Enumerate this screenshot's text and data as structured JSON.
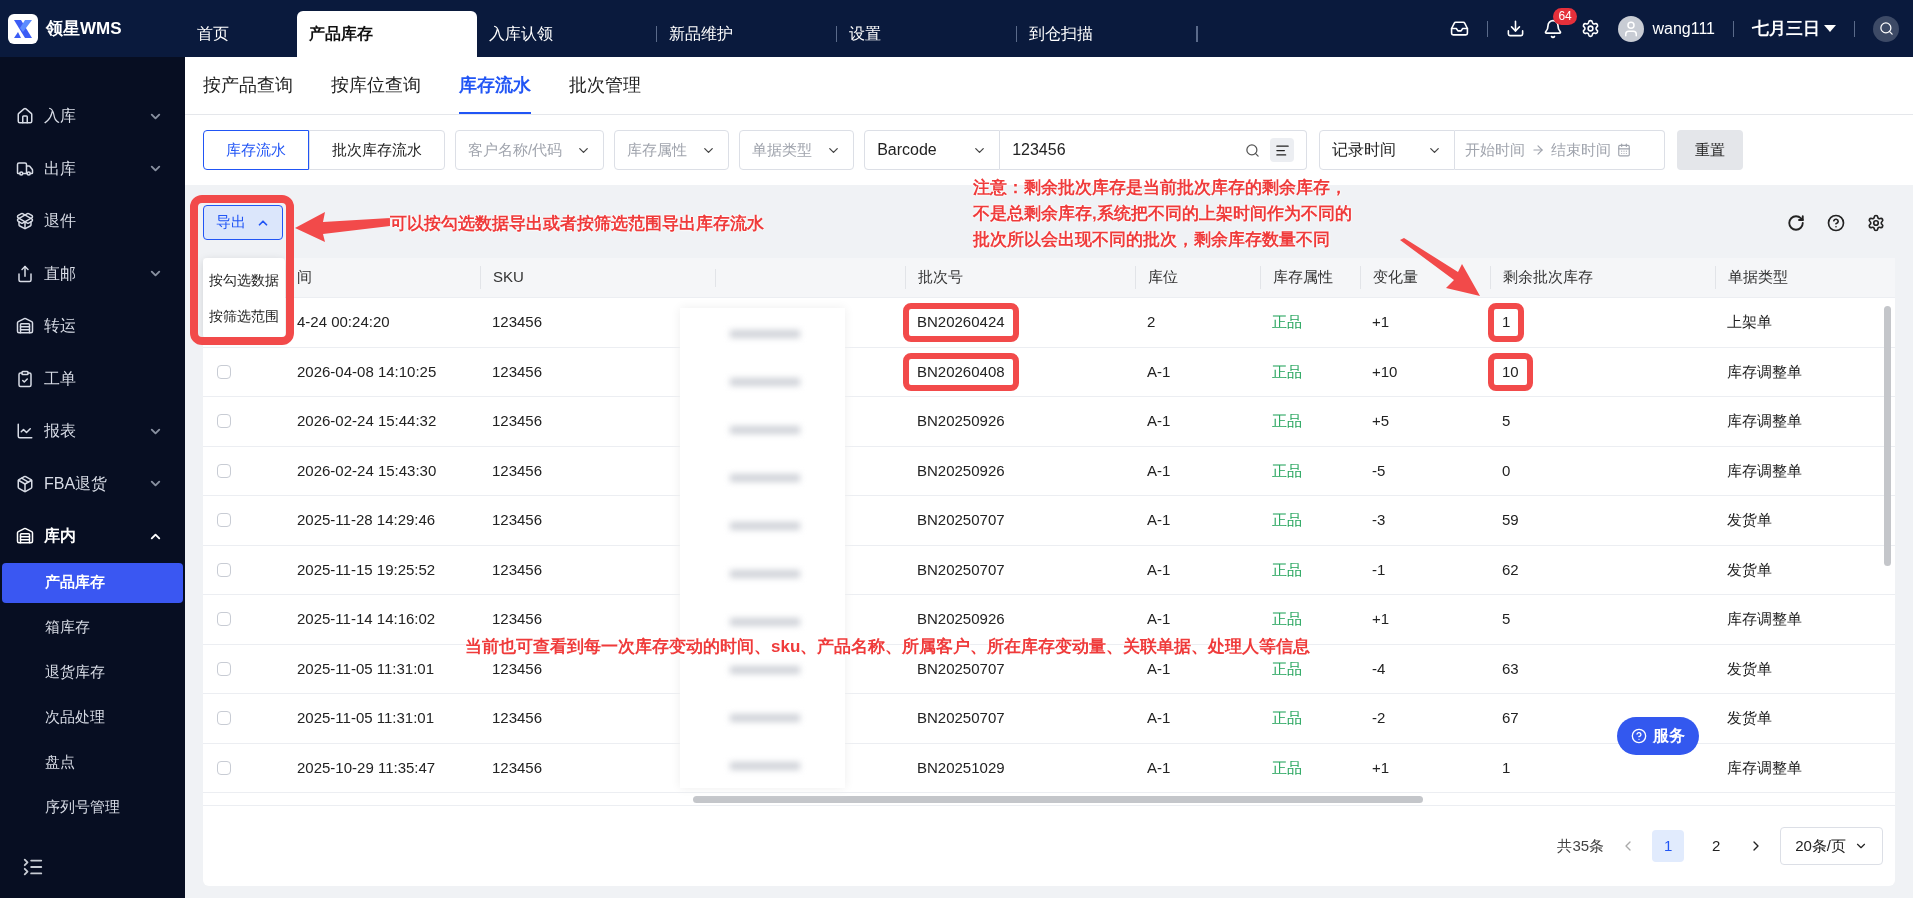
{
  "app": {
    "name": "领星WMS"
  },
  "nav_tabs": [
    {
      "label": "首页",
      "selected": false
    },
    {
      "label": "产品库存",
      "selected": true
    },
    {
      "label": "入库认领",
      "selected": false
    },
    {
      "label": "新品维护",
      "selected": false
    },
    {
      "label": "设置",
      "selected": false
    },
    {
      "label": "到仓扫描",
      "selected": false
    }
  ],
  "header": {
    "notification_count": "64",
    "user": "wang111",
    "store": "七月三日"
  },
  "sidebar": {
    "items": [
      {
        "label": "入库",
        "expandable": true,
        "expanded": false
      },
      {
        "label": "出库",
        "expandable": true,
        "expanded": false
      },
      {
        "label": "退件",
        "expandable": false,
        "expanded": false
      },
      {
        "label": "直邮",
        "expandable": true,
        "expanded": false
      },
      {
        "label": "转运",
        "expandable": false,
        "expanded": false
      },
      {
        "label": "工单",
        "expandable": false,
        "expanded": false
      },
      {
        "label": "报表",
        "expandable": true,
        "expanded": false
      },
      {
        "label": "FBA退货",
        "expandable": true,
        "expanded": false
      },
      {
        "label": "库内",
        "expandable": true,
        "expanded": true,
        "children": [
          {
            "label": "产品库存",
            "selected": true
          },
          {
            "label": "箱库存",
            "selected": false
          },
          {
            "label": "退货库存",
            "selected": false
          },
          {
            "label": "次品处理",
            "selected": false
          },
          {
            "label": "盘点",
            "selected": false
          },
          {
            "label": "序列号管理",
            "selected": false
          }
        ]
      }
    ]
  },
  "sub_tabs": [
    {
      "label": "按产品查询",
      "selected": false
    },
    {
      "label": "按库位查询",
      "selected": false
    },
    {
      "label": "库存流水",
      "selected": true
    },
    {
      "label": "批次管理",
      "selected": false
    }
  ],
  "filters": {
    "mode": [
      {
        "label": "库存流水",
        "selected": true
      },
      {
        "label": "批次库存流水",
        "selected": false
      }
    ],
    "selects": [
      {
        "placeholder": "客户名称/代码"
      },
      {
        "placeholder": "库存属性"
      },
      {
        "placeholder": "单据类型"
      }
    ],
    "search_type": "Barcode",
    "search_value": "123456",
    "time_type": "记录时间",
    "start_placeholder": "开始时间",
    "end_placeholder": "结束时间",
    "reset": "重置"
  },
  "export": {
    "label": "导出",
    "expanded": true,
    "menu": [
      "按勾选数据",
      "按筛选范围"
    ]
  },
  "table": {
    "columns": [
      "间",
      "SKU",
      "批次号",
      "库位",
      "库存属性",
      "变化量",
      "剩余批次库存",
      "单据类型"
    ],
    "rows": [
      {
        "time": "4-24 00:24:20",
        "sku": "123456",
        "batch": "BN20260424",
        "batch_marked": true,
        "location": "2",
        "attribute": "正品",
        "change": "+1",
        "remaining": "1",
        "remaining_marked": true,
        "doc_type": "上架单"
      },
      {
        "checked": false,
        "time": "2026-04-08 14:10:25",
        "sku": "123456",
        "batch": "BN20260408",
        "batch_marked": true,
        "location": "A-1",
        "attribute": "正品",
        "change": "+10",
        "remaining": "10",
        "remaining_marked": true,
        "doc_type": "库存调整单"
      },
      {
        "checked": false,
        "time": "2026-02-24 15:44:32",
        "sku": "123456",
        "batch": "BN20250926",
        "batch_marked": false,
        "location": "A-1",
        "attribute": "正品",
        "change": "+5",
        "remaining": "5",
        "remaining_marked": false,
        "doc_type": "库存调整单"
      },
      {
        "checked": false,
        "time": "2026-02-24 15:43:30",
        "sku": "123456",
        "batch": "BN20250926",
        "batch_marked": false,
        "location": "A-1",
        "attribute": "正品",
        "change": "-5",
        "remaining": "0",
        "remaining_marked": false,
        "doc_type": "库存调整单"
      },
      {
        "checked": false,
        "time": "2025-11-28 14:29:46",
        "sku": "123456",
        "batch": "BN20250707",
        "batch_marked": false,
        "location": "A-1",
        "attribute": "正品",
        "change": "-3",
        "remaining": "59",
        "remaining_marked": false,
        "doc_type": "发货单"
      },
      {
        "checked": false,
        "time": "2025-11-15 19:25:52",
        "sku": "123456",
        "batch": "BN20250707",
        "batch_marked": false,
        "location": "A-1",
        "attribute": "正品",
        "change": "-1",
        "remaining": "62",
        "remaining_marked": false,
        "doc_type": "发货单"
      },
      {
        "checked": false,
        "time": "2025-11-14 14:16:02",
        "sku": "123456",
        "batch": "BN20250926",
        "batch_marked": false,
        "location": "A-1",
        "attribute": "正品",
        "change": "+1",
        "remaining": "5",
        "remaining_marked": false,
        "doc_type": "库存调整单"
      },
      {
        "checked": false,
        "time": "2025-11-05 11:31:01",
        "sku": "123456",
        "batch": "BN20250707",
        "batch_marked": false,
        "location": "A-1",
        "attribute": "正品",
        "change": "-4",
        "remaining": "63",
        "remaining_marked": false,
        "doc_type": "发货单"
      },
      {
        "checked": false,
        "time": "2025-11-05 11:31:01",
        "sku": "123456",
        "batch": "BN20250707",
        "batch_marked": false,
        "location": "A-1",
        "attribute": "正品",
        "change": "-2",
        "remaining": "67",
        "remaining_marked": false,
        "doc_type": "发货单"
      },
      {
        "checked": false,
        "time": "2025-10-29 11:35:47",
        "sku": "123456",
        "batch": "BN20251029",
        "batch_marked": false,
        "location": "A-1",
        "attribute": "正品",
        "change": "+1",
        "remaining": "1",
        "remaining_marked": false,
        "doc_type": "库存调整单"
      }
    ]
  },
  "pagination": {
    "total": "共35条",
    "pages": [
      {
        "label": "1",
        "selected": true
      },
      {
        "label": "2",
        "selected": false
      }
    ],
    "page_size": "20条/页"
  },
  "service_button": "服务",
  "annotations": {
    "export_note": "可以按勾选数据导出或者按筛选范围导出库存流水",
    "batch_note": [
      "注意：剩余批次库存是当前批次库存的剩余库存，",
      "不是总剩余库存,系统把不同的上架时间作为不同的",
      "批次所以会出现不同的批次，剩余库存数量不同"
    ],
    "table_note": "当前也可查看到每一次库存变动的时间、sku、产品名称、所属客户、所在库存变动量、关联单据、处理人等信息"
  }
}
